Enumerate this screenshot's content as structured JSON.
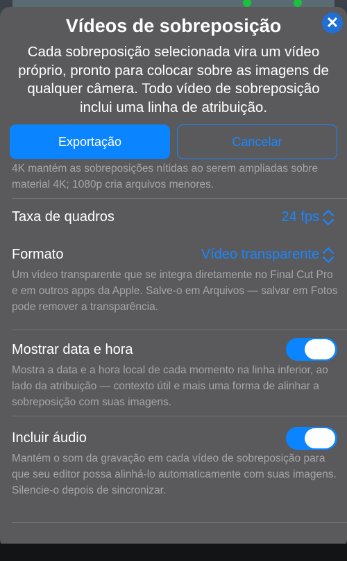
{
  "dialog": {
    "title": "Vídeos de sobreposição",
    "subtitle": "Cada sobreposição selecionada vira um vídeo próprio, pronto para colocar sobre as imagens de qualquer câmera. Todo vídeo de sobreposição inclui uma linha de atribuição.",
    "close_icon": "close-icon"
  },
  "buttons": {
    "export_label": "Exportação",
    "cancel_label": "Cancelar"
  },
  "resolution": {
    "desc": "4K mantém as sobreposições nítidas ao serem ampliadas sobre material 4K; 1080p cria arquivos menores."
  },
  "frame_rate": {
    "label": "Taxa de quadros",
    "value": "24 fps"
  },
  "format": {
    "label": "Formato",
    "value": "Vídeo transparente",
    "desc": "Um vídeo transparente que se integra diretamente no Final Cut Pro e em outros apps da Apple. Salve-o em Arquivos — salvar em Fotos pode remover a transparência."
  },
  "show_datetime": {
    "label": "Mostrar data e hora",
    "enabled": true,
    "desc": "Mostra a data e a hora local de cada momento na linha inferior, ao lado da atribuição — contexto útil e mais uma forma de alinhar a sobreposição com suas imagens."
  },
  "include_audio": {
    "label": "Incluir áudio",
    "enabled": true,
    "desc": "Mantém o som da gravação em cada vídeo de sobreposição para que seu editor possa alinhá-lo automaticamente com suas imagens. Silencie-o depois de sincronizar."
  },
  "colors": {
    "accent": "#0a84ff",
    "sheet": "#5a5a5c",
    "secondary_text": "#a6a6a8"
  }
}
